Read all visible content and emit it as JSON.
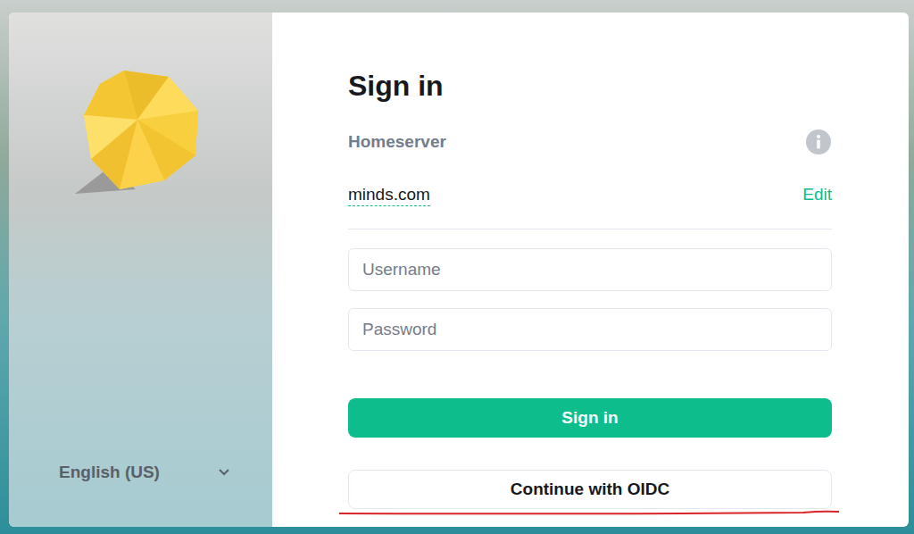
{
  "page": {
    "title": "Sign in"
  },
  "homeserver": {
    "label": "Homeserver",
    "server": "minds.com",
    "edit": "Edit"
  },
  "fields": [
    {
      "name": "username",
      "placeholder": "Username",
      "type": "text"
    },
    {
      "name": "password",
      "placeholder": "Password",
      "type": "password"
    }
  ],
  "buttons": [
    {
      "label": "Sign in",
      "kind": "primary"
    },
    {
      "label": "Continue with OIDC",
      "kind": "secondary",
      "highlighted": true
    }
  ],
  "language": {
    "label": "English (US)"
  }
}
